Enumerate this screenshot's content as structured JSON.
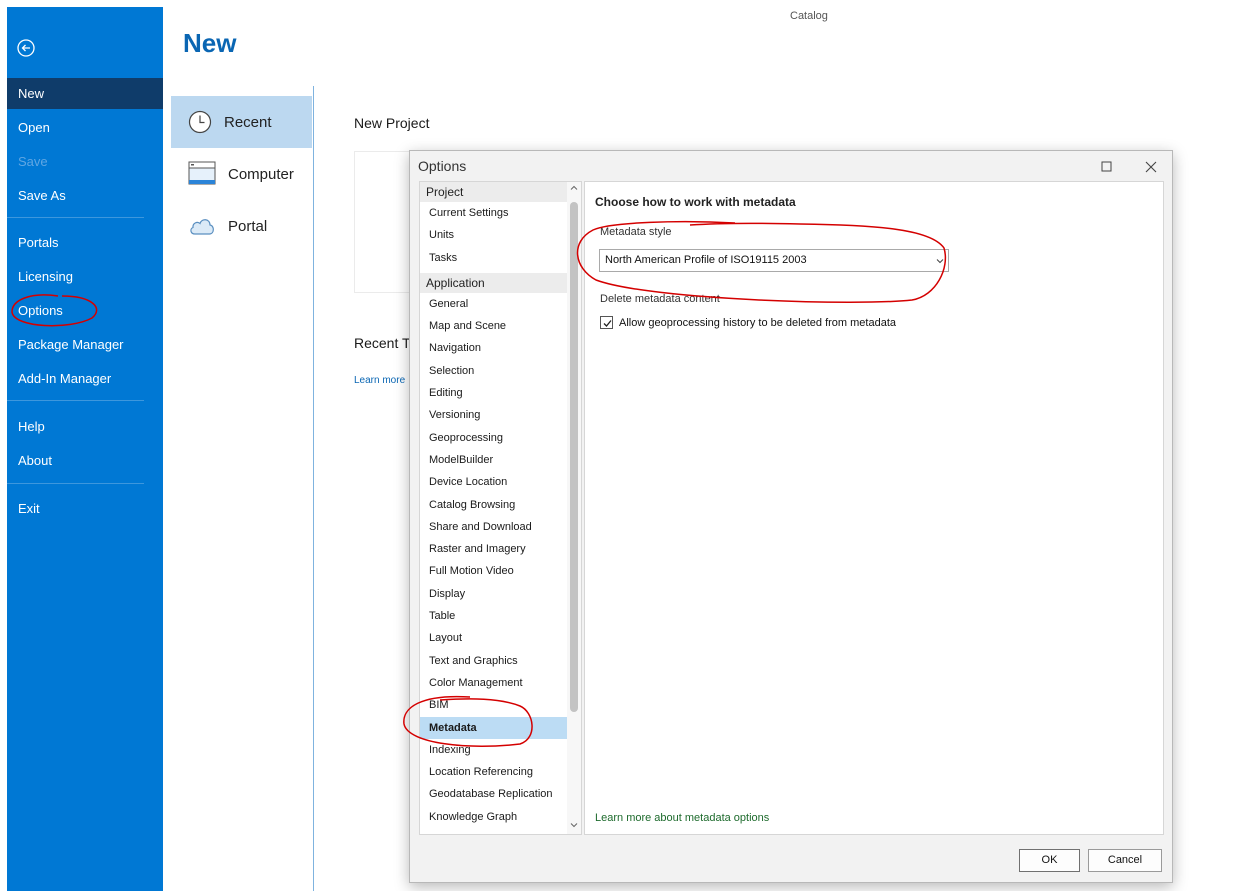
{
  "app_title": "Catalog",
  "backstage": {
    "back_icon": "back-arrow-icon",
    "items": [
      {
        "label": "New",
        "state": "active"
      },
      {
        "label": "Open",
        "state": "normal"
      },
      {
        "label": "Save",
        "state": "disabled"
      },
      {
        "label": "Save As",
        "state": "normal"
      },
      {
        "label": "Portals",
        "state": "normal"
      },
      {
        "label": "Licensing",
        "state": "normal"
      },
      {
        "label": "Options",
        "state": "normal"
      },
      {
        "label": "Package Manager",
        "state": "normal"
      },
      {
        "label": "Add-In Manager",
        "state": "normal"
      },
      {
        "label": "Help",
        "state": "normal"
      },
      {
        "label": "About",
        "state": "normal"
      },
      {
        "label": "Exit",
        "state": "normal"
      }
    ]
  },
  "main": {
    "title": "New",
    "locations": [
      {
        "label": "Recent",
        "icon": "clock-icon",
        "active": true
      },
      {
        "label": "Computer",
        "icon": "computer-icon",
        "active": false
      },
      {
        "label": "Portal",
        "icon": "cloud-icon",
        "active": false
      }
    ],
    "new_project_label": "New Project",
    "recent_templates_label": "Recent T",
    "learn_more_label": "Learn more"
  },
  "dialog": {
    "title": "Options",
    "nav_groups": [
      {
        "label": "Project",
        "items": [
          "Current Settings",
          "Units",
          "Tasks"
        ]
      },
      {
        "label": "Application",
        "items": [
          "General",
          "Map and Scene",
          "Navigation",
          "Selection",
          "Editing",
          "Versioning",
          "Geoprocessing",
          "ModelBuilder",
          "Device Location",
          "Catalog Browsing",
          "Share and Download",
          "Raster and Imagery",
          "Full Motion Video",
          "Display",
          "Table",
          "Layout",
          "Text and Graphics",
          "Color Management",
          "BIM",
          "Metadata",
          "Indexing",
          "Location Referencing",
          "Geodatabase Replication",
          "Knowledge Graph"
        ]
      }
    ],
    "selected_item": "Metadata",
    "content": {
      "heading": "Choose how to work with metadata",
      "metadata_style_label": "Metadata style",
      "metadata_style_value": "North American Profile of ISO19115 2003",
      "delete_label": "Delete metadata content",
      "allow_history_label": "Allow geoprocessing history to be deleted from metadata",
      "allow_history_checked": true,
      "learn_more_label": "Learn more about metadata options"
    },
    "ok_label": "OK",
    "cancel_label": "Cancel"
  },
  "colors": {
    "rail": "#0078d4",
    "rail_active": "#0f3c6a",
    "accent": "#0a66b3",
    "annotation": "#d40000"
  }
}
